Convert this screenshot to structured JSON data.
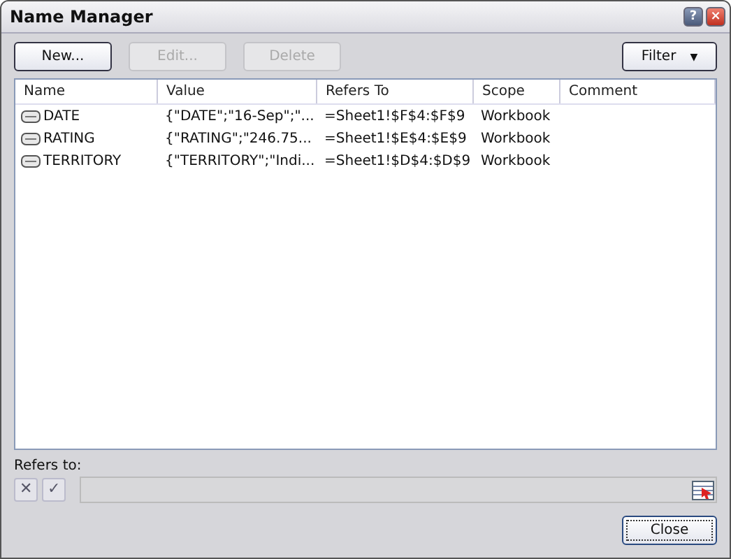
{
  "window": {
    "title": "Name Manager",
    "controls": [
      "?",
      "×"
    ]
  },
  "buttons": [
    {
      "label": "New...",
      "disabled": false
    },
    {
      "label": "Edit...",
      "disabled": true
    },
    {
      "label": "Delete",
      "disabled": true
    }
  ],
  "filter": {
    "label": "Filter",
    "arrow": "▼"
  },
  "table": {
    "columns": [
      "Name",
      "Value",
      "Refers To",
      "Scope",
      "Comment"
    ],
    "rows": [
      {
        "name": "DATE",
        "value": "{\"DATE\";\"16-Sep\";\"...",
        "refers_to": "=Sheet1!$F$4:$F$9",
        "scope": "Workbook"
      },
      {
        "name": "RATING",
        "value": "{\"RATING\";\"246.75...",
        "refers_to": "=Sheet1!$E$4:$E$9",
        "scope": "Workbook"
      },
      {
        "name": "TERRITORY",
        "value": "{\"TERRITORY\";\"Indi...",
        "refers_to": "=Sheet1!$D$4:$D$9",
        "scope": "Workbook"
      }
    ]
  },
  "refers_to": {
    "label": "Refers to:",
    "cancel": "✕",
    "confirm": "✓"
  },
  "close_button": "Close"
}
